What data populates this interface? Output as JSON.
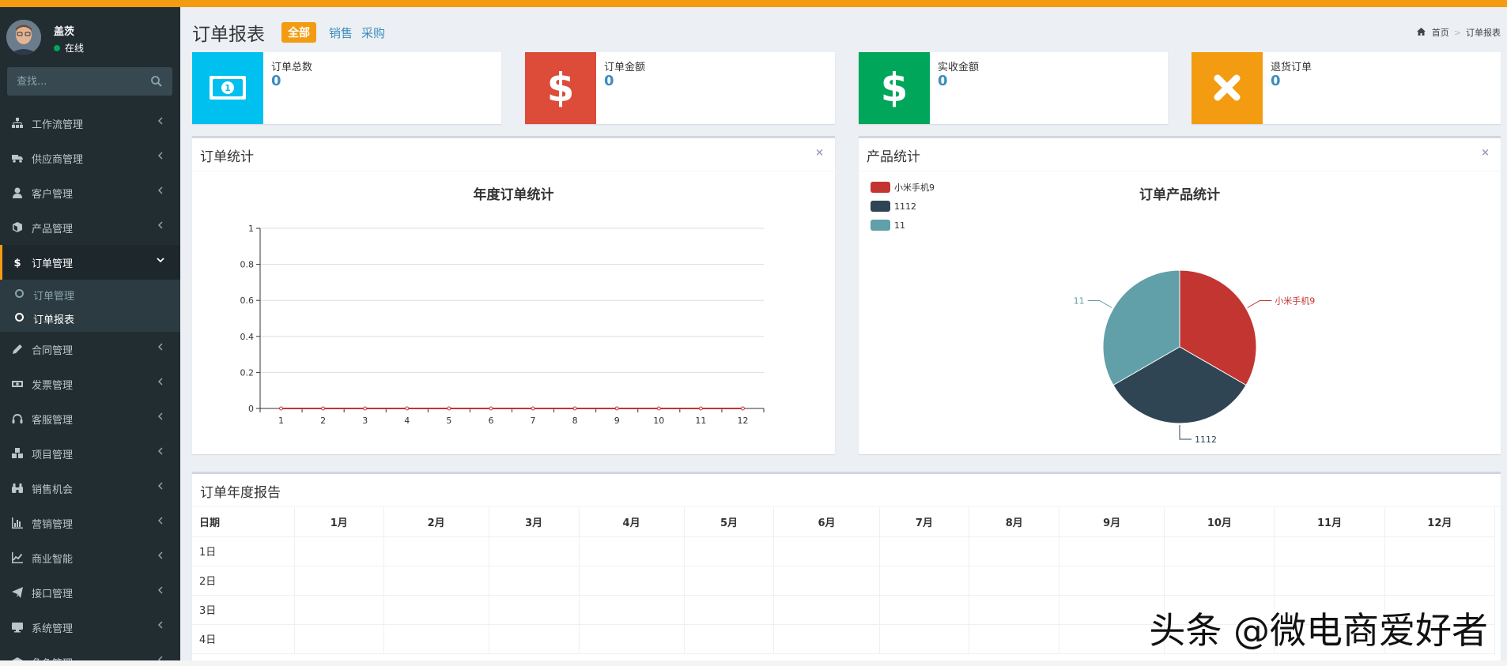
{
  "user": {
    "name": "盖茨",
    "status": "在线"
  },
  "search": {
    "placeholder": "查找..."
  },
  "menu": [
    {
      "label": "工作流管理",
      "icon": "sitemap-icon"
    },
    {
      "label": "供应商管理",
      "icon": "truck-icon"
    },
    {
      "label": "客户管理",
      "icon": "user-icon"
    },
    {
      "label": "产品管理",
      "icon": "cube-icon"
    },
    {
      "label": "订单管理",
      "icon": "dollar-icon",
      "active": true,
      "children": [
        {
          "label": "订单管理"
        },
        {
          "label": "订单报表",
          "active": true
        }
      ]
    },
    {
      "label": "合同管理",
      "icon": "pencil-icon"
    },
    {
      "label": "发票管理",
      "icon": "money-icon"
    },
    {
      "label": "客服管理",
      "icon": "headphones-icon"
    },
    {
      "label": "项目管理",
      "icon": "cubes-icon"
    },
    {
      "label": "销售机会",
      "icon": "binoculars-icon"
    },
    {
      "label": "营销管理",
      "icon": "bar-chart-icon"
    },
    {
      "label": "商业智能",
      "icon": "line-chart-icon"
    },
    {
      "label": "接口管理",
      "icon": "paper-plane-icon"
    },
    {
      "label": "系统管理",
      "icon": "desktop-icon"
    },
    {
      "label": "角色管理",
      "icon": "graduation-cap-icon"
    }
  ],
  "header": {
    "title": "订单报表",
    "tabs": {
      "all": "全部",
      "sales": "销售",
      "purchase": "采购"
    },
    "breadcrumb": {
      "home": "首页",
      "current": "订单报表"
    }
  },
  "info_boxes": [
    {
      "label": "订单总数",
      "value": "0",
      "color": "#00c0ef",
      "icon": "money-bill-icon"
    },
    {
      "label": "订单金额",
      "value": "0",
      "color": "#dd4b39",
      "icon": "dollar-icon"
    },
    {
      "label": "实收金额",
      "value": "0",
      "color": "#00a65a",
      "icon": "dollar-icon"
    },
    {
      "label": "退货订单",
      "value": "0",
      "color": "#f39c12",
      "icon": "times-icon"
    }
  ],
  "order_box": {
    "title": "订单统计",
    "close": "×"
  },
  "product_box": {
    "title": "产品统计",
    "close": "×"
  },
  "report_box": {
    "title": "订单年度报告"
  },
  "chart_data": [
    {
      "type": "line",
      "title": "年度订单统计",
      "categories": [
        "1",
        "2",
        "3",
        "4",
        "5",
        "6",
        "7",
        "8",
        "9",
        "10",
        "11",
        "12"
      ],
      "series": [
        {
          "values": [
            0,
            0,
            0,
            0,
            0,
            0,
            0,
            0,
            0,
            0,
            0,
            0
          ],
          "color": "#c23531"
        }
      ],
      "yticks": [
        "0",
        "0.2",
        "0.4",
        "0.6",
        "0.8",
        "1"
      ],
      "ylim": [
        0,
        1
      ],
      "grid": true
    },
    {
      "type": "pie",
      "title": "订单产品统计",
      "slices": [
        {
          "name": "小米手机9",
          "value": 1,
          "color": "#c23531"
        },
        {
          "name": "1112",
          "value": 1,
          "color": "#2f4554"
        },
        {
          "name": "11",
          "value": 1,
          "color": "#61a0a8"
        }
      ],
      "legend": "top-left"
    }
  ],
  "report_table": {
    "headers": [
      "日期",
      "1月",
      "2月",
      "3月",
      "4月",
      "5月",
      "6月",
      "7月",
      "8月",
      "9月",
      "10月",
      "11月",
      "12月"
    ],
    "rows": [
      "1日",
      "2日",
      "3日",
      "4日"
    ]
  },
  "watermark": "头条 @微电商爱好者"
}
